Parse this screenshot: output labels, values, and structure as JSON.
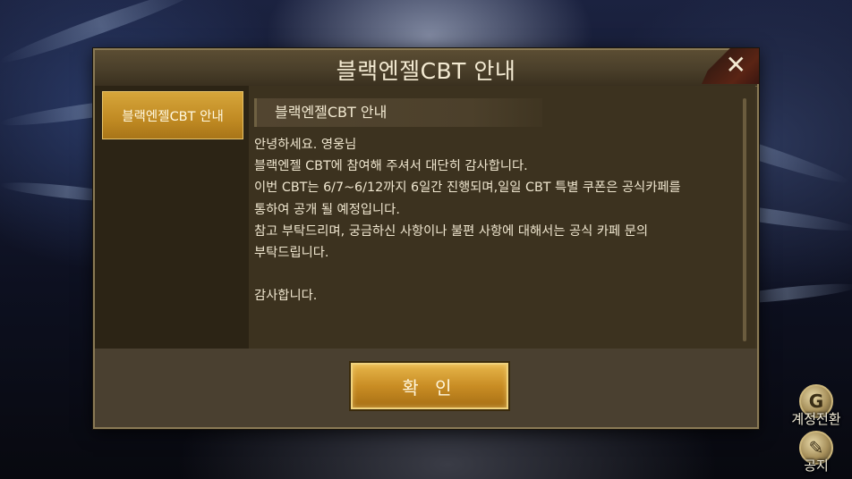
{
  "dialog": {
    "title": "블랙엔젤CBT 안내",
    "close_icon": "close-icon",
    "sidebar_tab": "블랙엔젤CBT 안내",
    "content_title": "블랙엔젤CBT 안내",
    "message_lines": [
      "안녕하세요. 영웅님",
      "블랙엔젤 CBT에 참여해 주셔서 대단히 감사합니다.",
      "이번 CBT는 6/7~6/12까지 6일간 진행되며,일일 CBT 특별 쿠폰은 공식카페를",
      "통하여 공개 될 예정입니다.",
      "참고 부탁드리며, 궁금하신 사항이나 불편 사항에 대해서는 공식 카페 문의",
      "부탁드립니다.",
      "",
      "감사합니다."
    ],
    "confirm_label": "확 인"
  },
  "side_buttons": {
    "switch_account": {
      "label": "계정전환",
      "icon": "account-switch-icon"
    },
    "notice": {
      "label": "공지",
      "icon": "notice-icon"
    }
  },
  "colors": {
    "dialog_bg": "#3f3524",
    "accent_gold": "#c98d24",
    "text": "#efe6cf"
  }
}
